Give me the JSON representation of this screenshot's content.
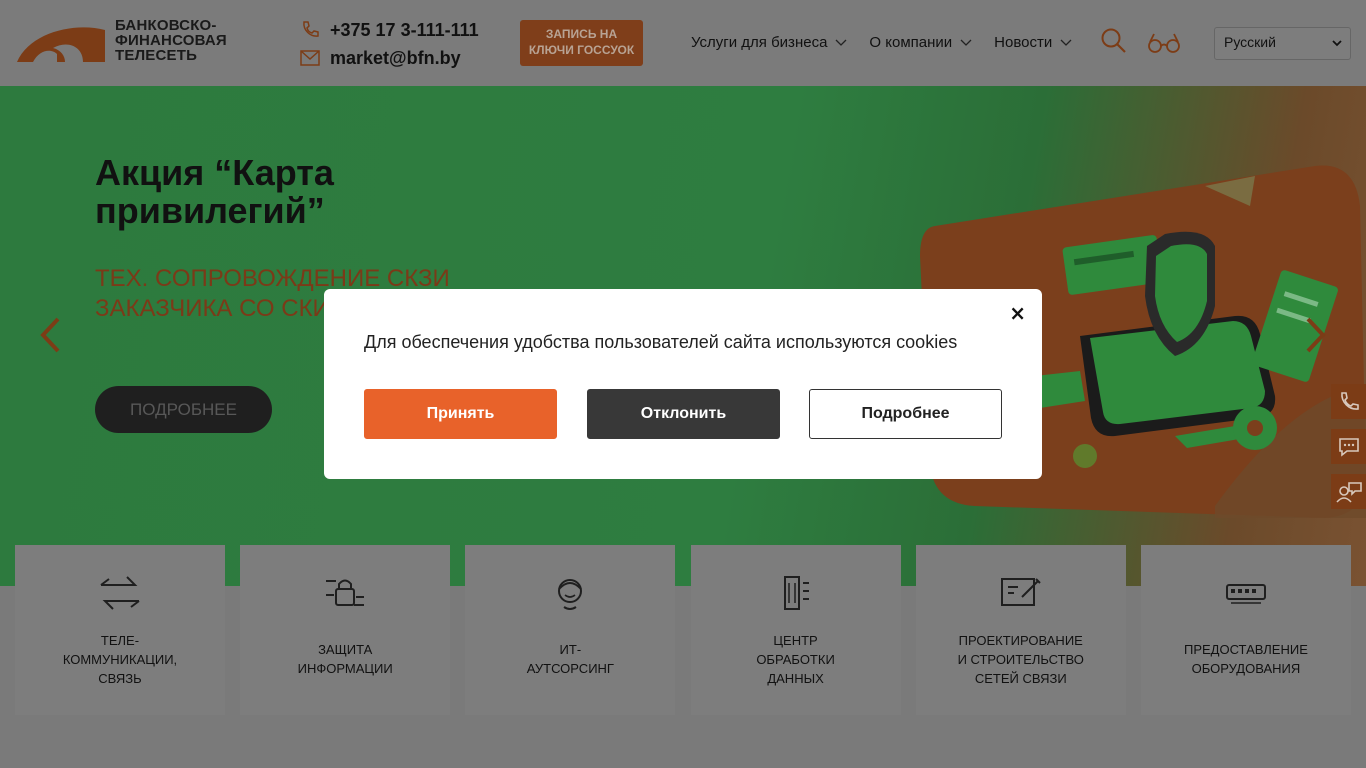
{
  "header": {
    "logo_lines": [
      "БАНКОВСКО-",
      "ФИНАНСОВАЯ",
      "ТЕЛЕСЕТЬ"
    ],
    "phone": "+375 17 3-111-111",
    "email": "market@bfn.by",
    "cta_lines": [
      "ЗАПИСЬ НА",
      "КЛЮЧИ ГОССУОК"
    ],
    "nav": [
      {
        "label": "Услуги для бизнеса"
      },
      {
        "label": "О компании"
      },
      {
        "label": "Новости"
      }
    ],
    "language": "Русский",
    "accent": "#e8622a"
  },
  "hero": {
    "title": "Акция “Карта привилегий”",
    "subtitle": "ТЕХ. СОПРОВОЖДЕНИЕ СКЗИ ЗАКАЗЧИКА СО СКИДКОЙ",
    "button": "ПОДРОБНЕЕ"
  },
  "services": [
    {
      "label": "ТЕЛЕ-\nКОММУНИКАЦИИ,\nСВЯЗЬ",
      "icon": "arrows-exchange-icon"
    },
    {
      "label": "ЗАЩИТА\nИНФОРМАЦИИ",
      "icon": "lock-network-icon"
    },
    {
      "label": "ИТ-\nАУТСОРСИНГ",
      "icon": "support-agent-icon"
    },
    {
      "label": "ЦЕНТР\nОБРАБОТКИ\nДАННЫХ",
      "icon": "datacenter-icon"
    },
    {
      "label": "ПРОЕКТИРОВАНИЕ\nИ СТРОИТЕЛЬСТВО\nСЕТЕЙ СВЯЗИ",
      "icon": "blueprint-pencil-icon"
    },
    {
      "label": "ПРЕДОСТАВЛЕНИЕ\nОБОРУДОВАНИЯ",
      "icon": "network-switch-icon"
    }
  ],
  "cookie_modal": {
    "text": "Для обеспечения удобства пользователей сайта используются cookies",
    "accept": "Принять",
    "decline": "Отклонить",
    "more": "Подробнее",
    "close": "×"
  }
}
